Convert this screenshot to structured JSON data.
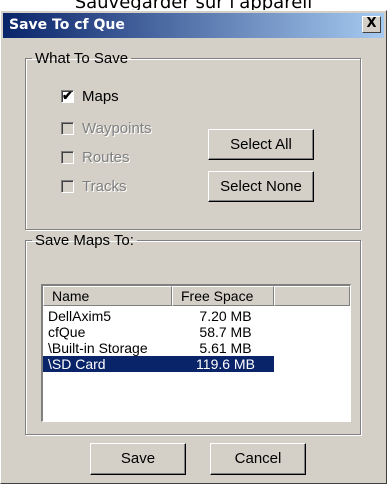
{
  "background_caption": "Sauvegarder sur l'appareil",
  "window": {
    "title": "Save To cf Que",
    "close_glyph": "X"
  },
  "what_to_save": {
    "legend": "What To Save",
    "items": [
      {
        "label": "Maps",
        "checked": true,
        "enabled": true
      },
      {
        "label": "Waypoints",
        "checked": false,
        "enabled": false
      },
      {
        "label": "Routes",
        "checked": false,
        "enabled": false
      },
      {
        "label": "Tracks",
        "checked": false,
        "enabled": false
      }
    ],
    "select_all_label": "Select All",
    "select_none_label": "Select None"
  },
  "save_maps_to": {
    "legend": "Save Maps To:",
    "columns": [
      "Name",
      "Free Space"
    ],
    "rows": [
      {
        "name": "DellAxim5",
        "free": "7.20 MB",
        "selected": false
      },
      {
        "name": "cfQue",
        "free": "58.7 MB",
        "selected": false
      },
      {
        "name": "\\Built-in Storage",
        "free": "5.61 MB",
        "selected": false
      },
      {
        "name": "\\SD Card",
        "free": "119.6 MB",
        "selected": true
      }
    ]
  },
  "buttons": {
    "save": "Save",
    "cancel": "Cancel"
  },
  "colors": {
    "titlebar_start": "#0a246a",
    "titlebar_end": "#a6caf0",
    "dialog_face": "#d4d0c8",
    "selection": "#0a246a"
  }
}
